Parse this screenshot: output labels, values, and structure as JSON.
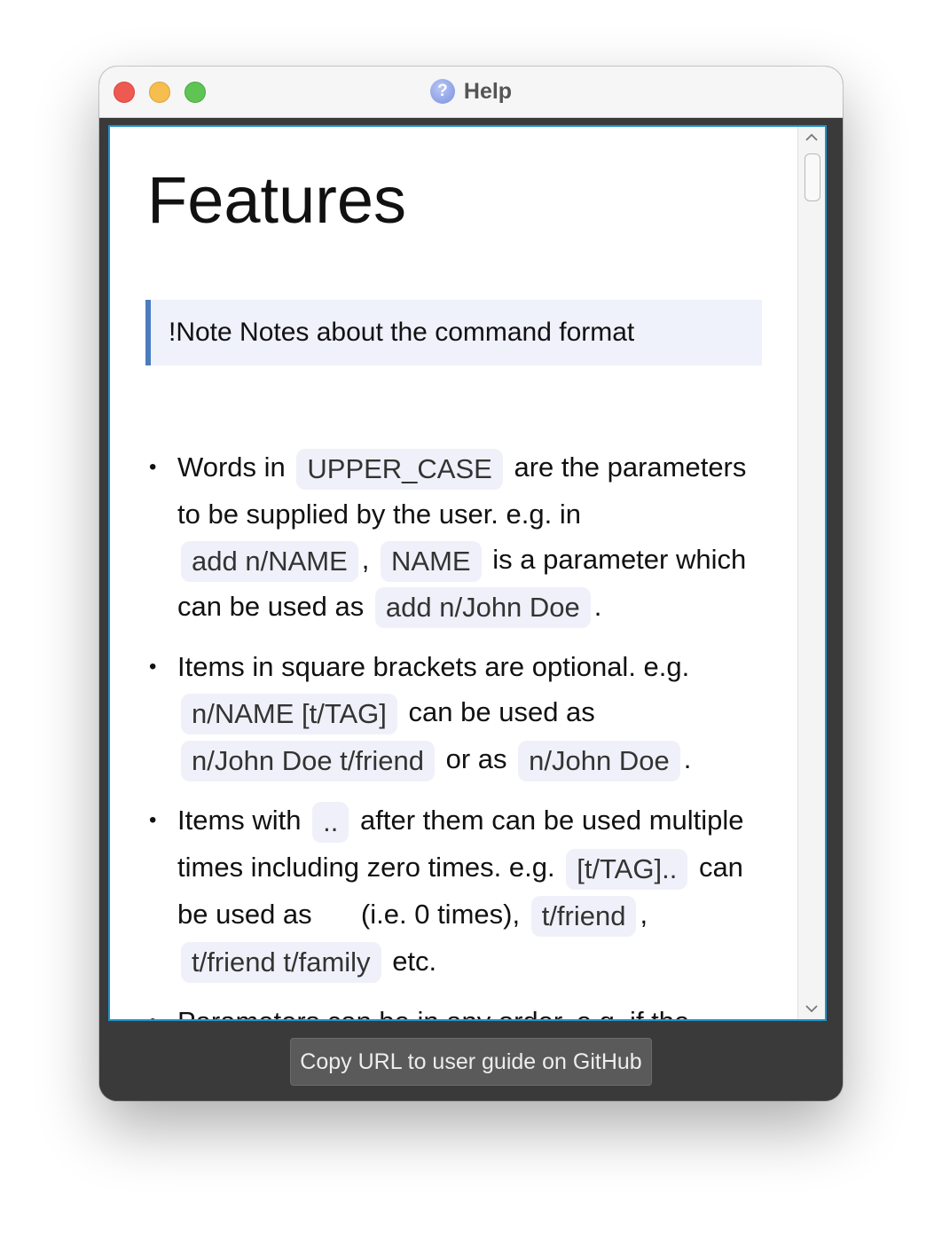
{
  "window": {
    "title": "Help"
  },
  "doc": {
    "heading": "Features",
    "note": "!Note Notes about the command format",
    "bullets": {
      "b1": {
        "t1": "Words in",
        "c1": "UPPER_CASE",
        "t2": "are the parameters to be supplied by the user. e.g. in",
        "c2": "add n/NAME",
        "t3": ",",
        "c3": "NAME",
        "t4": "is a parameter which can be used as",
        "c4": "add n/John Doe",
        "t5": "."
      },
      "b2": {
        "t1": "Items in square brackets are optional. e.g.",
        "c1": "n/NAME [t/TAG]",
        "t2": "can be used as",
        "c2": "n/John Doe t/friend",
        "t3": "or as",
        "c3": "n/John Doe",
        "t4": "."
      },
      "b3": {
        "t1": "Items with",
        "c1": "..",
        "t2": "after them can be used multiple times including zero times. e.g.",
        "c2": "[t/TAG]..",
        "t3": "can be used as",
        "c3": "",
        "t4": "(i.e. 0 times),",
        "c4": "t/friend",
        "t5": ",",
        "c5": "t/friend t/family",
        "t6": "etc."
      },
      "b4": {
        "t1": "Parameters can be in any order. e.g. if the"
      }
    }
  },
  "footer": {
    "copy_button": "Copy URL to user guide on GitHub"
  }
}
